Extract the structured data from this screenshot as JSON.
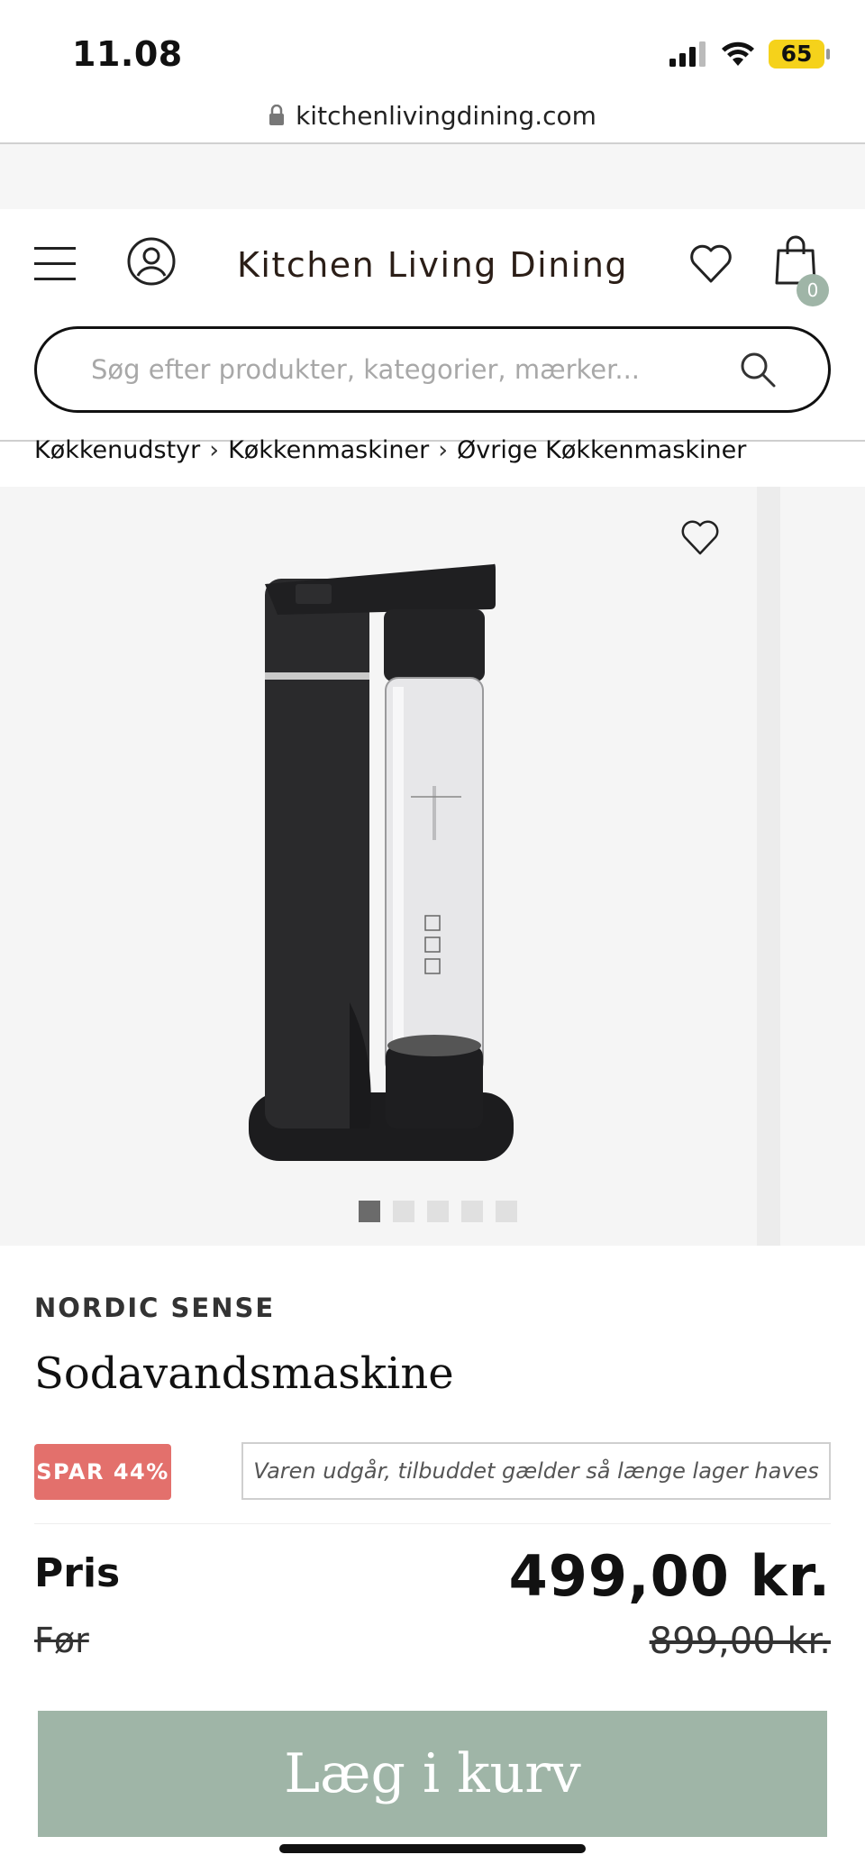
{
  "status_bar": {
    "time": "11.08",
    "battery": "65",
    "icons": [
      "signal-icon",
      "wifi-icon",
      "battery-charging-icon"
    ]
  },
  "browser": {
    "url": "kitchenlivingdining.com",
    "icons": [
      "lock-icon"
    ]
  },
  "header": {
    "logo_text": "Kitchen Living Dining",
    "cart_count": "0",
    "icons": [
      "menu-icon",
      "user-icon",
      "heart-icon",
      "bag-icon"
    ]
  },
  "search": {
    "placeholder": "Søg efter produkter, kategorier, mærker...",
    "value": ""
  },
  "breadcrumb": {
    "items": [
      "Køkkenudstyr",
      "Køkkenmaskiner",
      "Øvrige Køkkenmaskiner"
    ],
    "separator": "›"
  },
  "gallery": {
    "image_count": 5,
    "active_index": 0
  },
  "product": {
    "brand": "NORDIC SENSE",
    "title": "Sodavandsmaskine",
    "save_badge": "SPAR 44%",
    "notice": "Varen udgår, tilbuddet gælder så længe lager haves",
    "price_label": "Pris",
    "price": "499,00 kr.",
    "before_label": "Før",
    "before_price": "899,00 kr."
  },
  "cta": {
    "add_to_cart_label": "Læg i kurv"
  },
  "colors": {
    "accent_green": "#9fb5a7",
    "sale_red": "#e3706c",
    "battery_yellow": "#f5d21b"
  }
}
